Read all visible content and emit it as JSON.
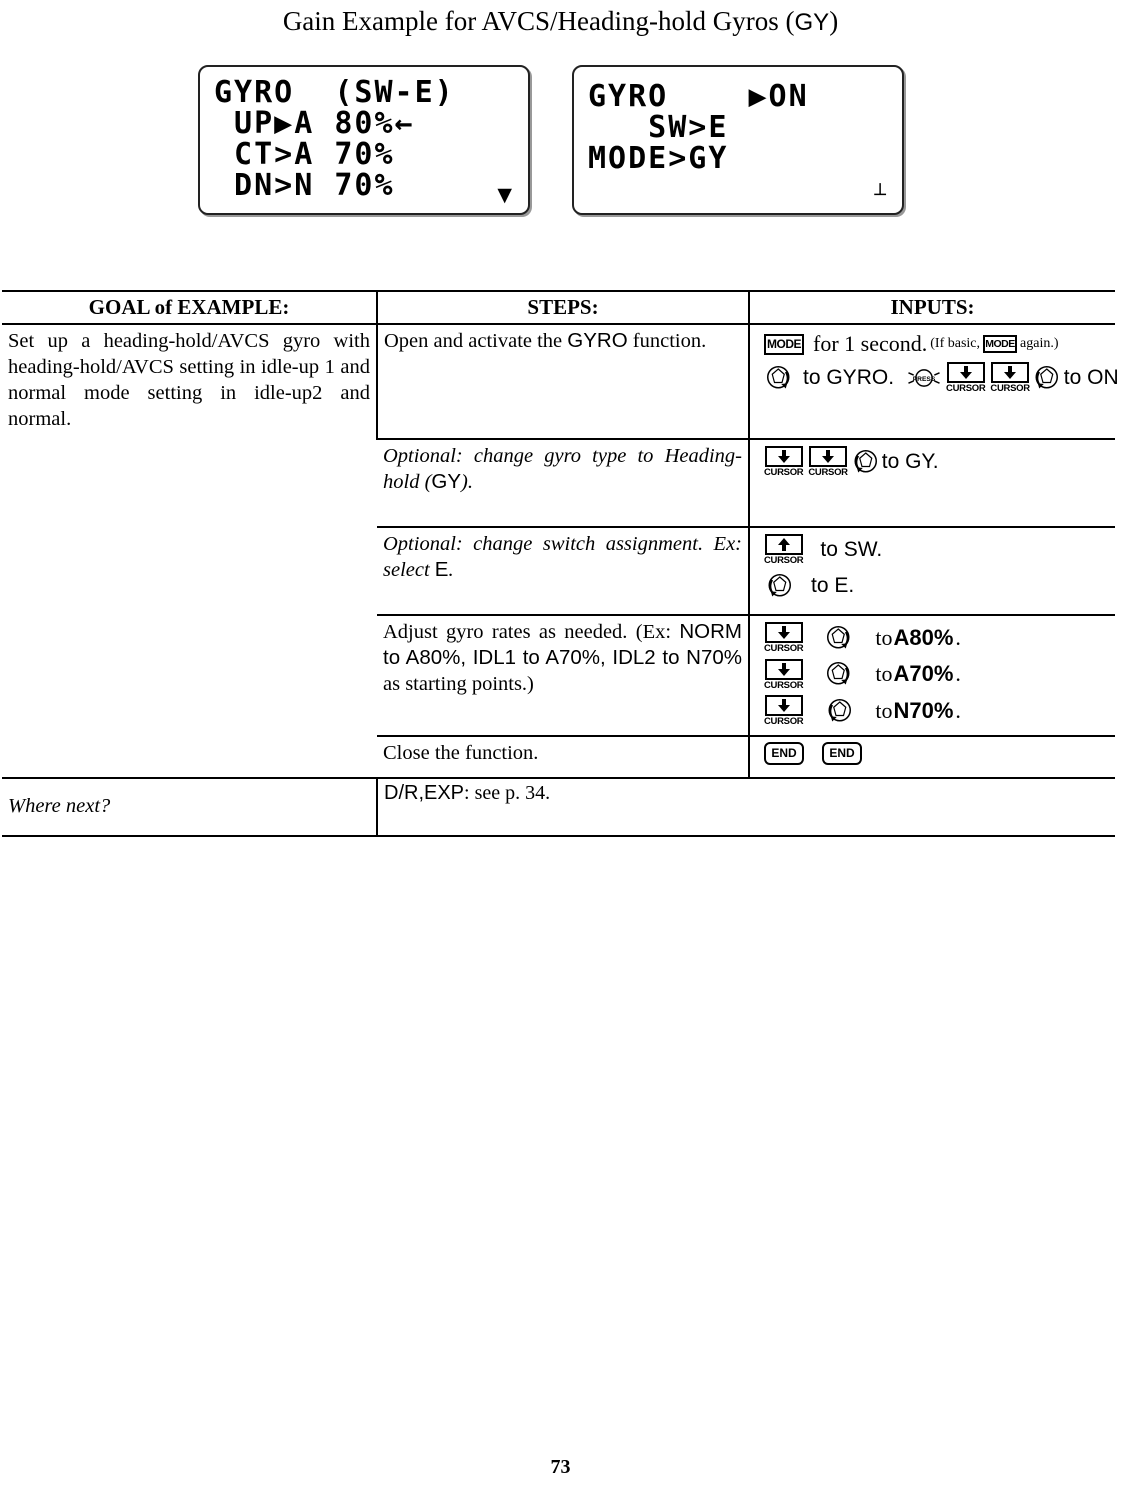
{
  "document": {
    "title": "Gain Example for AVCS/Heading-hold Gyros (GY)",
    "title_prefix": "Gain Example for AVCS/Heading-hold Gyros (",
    "title_code": "GY",
    "title_suffix": ")",
    "page_number": "73"
  },
  "lcd_screens": [
    {
      "name": "gyro-rates-screen",
      "lines": "GYRO  (SW-E)\n UP▶A 80%←\n CT>A 70%\n DN>N 70%",
      "corner_glyph": "▼"
    },
    {
      "name": "gyro-setup-screen",
      "lines": "GYRO    ▶ON\n   SW>E\nMODE>GY",
      "corner_glyph": "┴"
    }
  ],
  "table": {
    "headers": {
      "goal": "GOAL of EXAMPLE:",
      "steps": "STEPS:",
      "inputs": "INPUTS:"
    },
    "goal_text": "Set up a heading-hold/AVCS gyro with heading-hold/AVCS setting in idle-up 1 and normal mode setting in idle-up2 and normal.",
    "rows": [
      {
        "step_plain_1": "Open and activate the ",
        "step_code_1": "GYRO",
        "step_plain_2": " function.",
        "inputs": {
          "line1": {
            "key": "MODE",
            "text": "for 1 second.",
            "paren_open": "(If basic, ",
            "paren_key": "MODE",
            "paren_close": " again.)"
          },
          "line2": {
            "dial_text": "to GYRO.",
            "press_label": "PRESS",
            "cursor_label": "CURSOR",
            "dial2_text": "to ON"
          }
        }
      },
      {
        "step_ital_1": "Optional: change gyro type to Heading-hold (",
        "step_code": "GY",
        "step_ital_2": ").",
        "inputs": {
          "cursor_label": "CURSOR",
          "dial_text": "to GY."
        }
      },
      {
        "step_ital_1": "Optional: change switch assignment. Ex: select ",
        "step_code": "E",
        "step_ital_2": ".",
        "inputs": {
          "cursor_label": "CURSOR",
          "line1_text": "to SW.",
          "line2_text": "to E."
        }
      },
      {
        "step_plain_1": "Adjust gyro rates as needed. (Ex: ",
        "step_code": "NORM to A80%, IDL1 to A70%, IDL2 to N70%",
        "step_plain_2": " as starting points.)",
        "inputs": {
          "cursor_label": "CURSOR",
          "items": [
            {
              "to": "to ",
              "value": "A80%",
              "dot": "."
            },
            {
              "to": "to ",
              "value": "A70%",
              "dot": "."
            },
            {
              "to": "to ",
              "value": "N70%",
              "dot": "."
            }
          ]
        }
      },
      {
        "step_plain_1": "Close the function.",
        "inputs": {
          "end_label_1": "END",
          "end_label_2": "END"
        }
      }
    ],
    "where_next": {
      "label": "Where next?",
      "code": "D/R,EXP",
      "text": ": see p. 34."
    }
  },
  "colors": {
    "ink": "#000000",
    "paper": "#ffffff",
    "lcd_border": "#222222"
  }
}
